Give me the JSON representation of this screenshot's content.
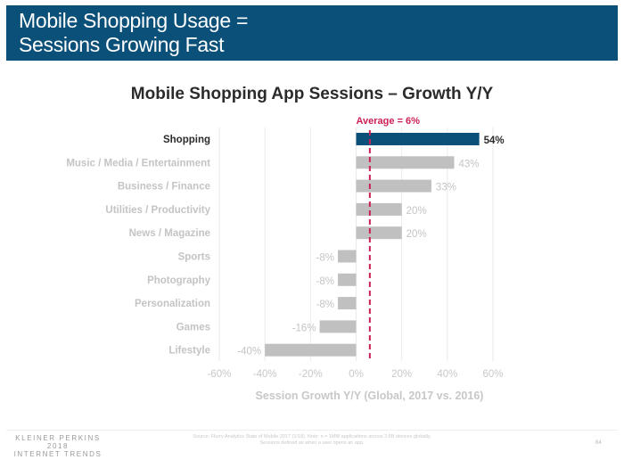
{
  "slide": {
    "header_title": "Mobile Shopping Usage =\nSessions Growing Fast",
    "colors": {
      "header_bg": "#0b5079",
      "highlight_bar": "#0b5079",
      "bar": "#c0c0c0",
      "average_line": "#cc1f54"
    },
    "footer": {
      "logo_line1": "KLEINER PERKINS",
      "logo_line2": "2018",
      "logo_line3": "INTERNET TRENDS",
      "source": "Source: Flurry Analytics State of Mobile 2017 (1/18). Note: n = 1MM applications across 2.6B devices globally. Sessions defined as when a user opens an app.",
      "page_number": "84"
    }
  },
  "chart_data": {
    "type": "bar",
    "orientation": "horizontal",
    "title": "Mobile Shopping App Sessions – Growth Y/Y",
    "xlabel": "Session Growth Y/Y (Global, 2017 vs. 2016)",
    "ylabel": "",
    "categories": [
      "Shopping",
      "Music / Media / Entertainment",
      "Business / Finance",
      "Utilities / Productivity",
      "News / Magazine",
      "Sports",
      "Photography",
      "Personalization",
      "Games",
      "Lifestyle"
    ],
    "values": [
      54,
      43,
      33,
      20,
      20,
      -8,
      -8,
      -8,
      -16,
      -40
    ],
    "value_labels": [
      "54%",
      "43%",
      "33%",
      "20%",
      "20%",
      "-8%",
      "-8%",
      "-8%",
      "-16%",
      "-40%"
    ],
    "highlight_category": "Shopping",
    "xlim": [
      -60,
      60
    ],
    "xticks": [
      -60,
      -40,
      -20,
      0,
      20,
      40,
      60
    ],
    "xtick_labels": [
      "-60%",
      "-40%",
      "-20%",
      "0%",
      "20%",
      "40%",
      "60%"
    ],
    "grid": "vertical",
    "reference_line": {
      "value": 6,
      "label": "Average = 6%",
      "style": "dashed"
    }
  }
}
